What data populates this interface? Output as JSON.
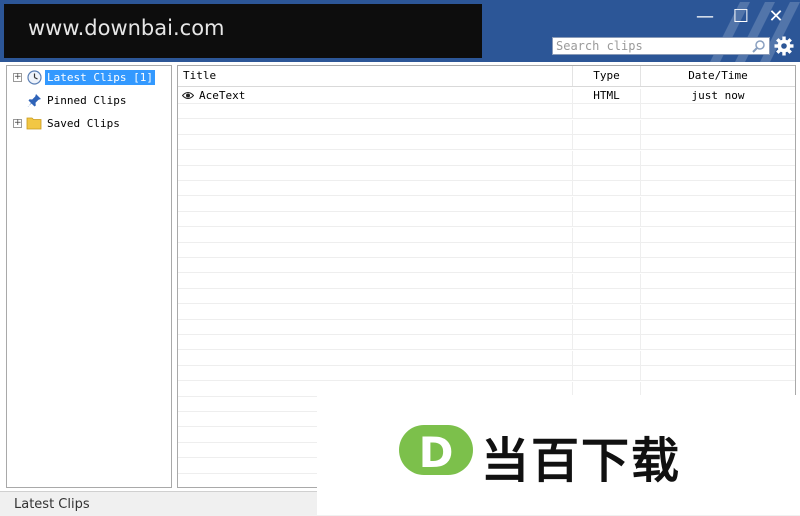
{
  "watermark_text": "www.downbai.com",
  "window_controls": {
    "minimize": "—",
    "maximize": "☐",
    "close": "✕"
  },
  "search": {
    "placeholder": "Search clips",
    "value": ""
  },
  "tree": {
    "items": [
      {
        "label": "Latest Clips [1]",
        "icon": "clock-icon",
        "selected": true,
        "expandable": true
      },
      {
        "label": "Pinned Clips",
        "icon": "pin-icon",
        "selected": false,
        "expandable": false
      },
      {
        "label": "Saved Clips",
        "icon": "folder-icon",
        "selected": false,
        "expandable": true
      }
    ]
  },
  "table": {
    "columns": [
      "Title",
      "Type",
      "Date/Time"
    ],
    "rows": [
      {
        "icon": "eye-icon",
        "title": "AceText",
        "type": "HTML",
        "datetime": "just now"
      }
    ]
  },
  "status": {
    "text": "Latest Clips"
  },
  "logo": {
    "text": "当百下载",
    "mark": "D"
  },
  "colors": {
    "titlebar": "#2c5697",
    "selection": "#3399ff",
    "logo_green": "#7cc04b"
  }
}
